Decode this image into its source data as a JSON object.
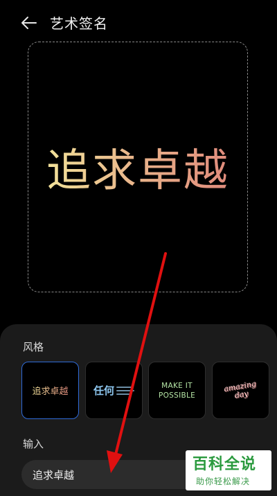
{
  "header": {
    "title": "艺术签名",
    "back_icon": "arrow-left-icon"
  },
  "preview": {
    "text": "追求卓越"
  },
  "style_section": {
    "label": "风格",
    "cards": [
      {
        "text": "追求卓越",
        "selected": true
      },
      {
        "main": "任何",
        "selected": false
      },
      {
        "line1": "MAKE IT",
        "line2": "POSSIBLE",
        "selected": false
      },
      {
        "line1": "amazing",
        "line2": "day",
        "selected": false
      }
    ]
  },
  "input_section": {
    "label": "输入",
    "value": "追求卓越"
  },
  "watermark": {
    "title": "百科全说",
    "subtitle": "助你轻松解决"
  },
  "colors": {
    "accent": "#2f6bd8",
    "arrow": "#e01010",
    "panel": "#1b1b1b"
  }
}
